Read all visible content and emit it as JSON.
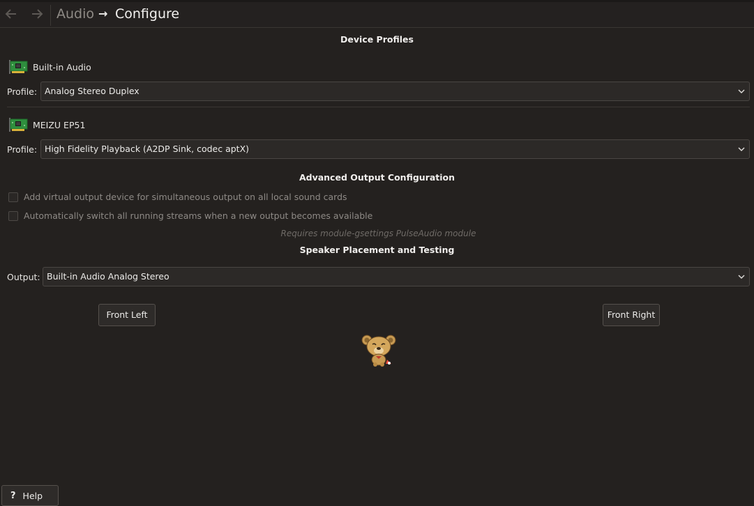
{
  "header": {
    "back_icon": "arrow-left-icon",
    "forward_icon": "arrow-right-icon",
    "breadcrumb_parent": "Audio",
    "breadcrumb_arrow": "→",
    "breadcrumb_current": "Configure"
  },
  "device_profiles": {
    "title": "Device Profiles",
    "devices": [
      {
        "name": "Built-in Audio",
        "icon": "sound-card-icon",
        "profile_label": "Profile:",
        "profile_value": "Analog Stereo Duplex"
      },
      {
        "name": "MEIZU EP51",
        "icon": "sound-card-icon",
        "profile_label": "Profile:",
        "profile_value": "High Fidelity Playback (A2DP Sink, codec aptX)"
      }
    ]
  },
  "advanced_output": {
    "title": "Advanced Output Configuration",
    "options": [
      {
        "label": "Add virtual output device for simultaneous output on all local sound cards",
        "checked": false
      },
      {
        "label": "Automatically switch all running streams when a new output becomes available",
        "checked": false
      }
    ],
    "note": "Requires module-gsettings PulseAudio module"
  },
  "speaker_testing": {
    "title": "Speaker Placement and Testing",
    "output_label": "Output:",
    "output_value": "Built-in Audio Analog Stereo",
    "front_left": "Front Left",
    "front_right": "Front Right",
    "listener_icon": "bear-listener-icon"
  },
  "footer": {
    "help_icon": "?",
    "help_label": "Help"
  },
  "colors": {
    "background": "#24211f",
    "card_green": "#2f8f3e",
    "text": "#e6e4e1",
    "disabled_text": "#8e8a86"
  }
}
